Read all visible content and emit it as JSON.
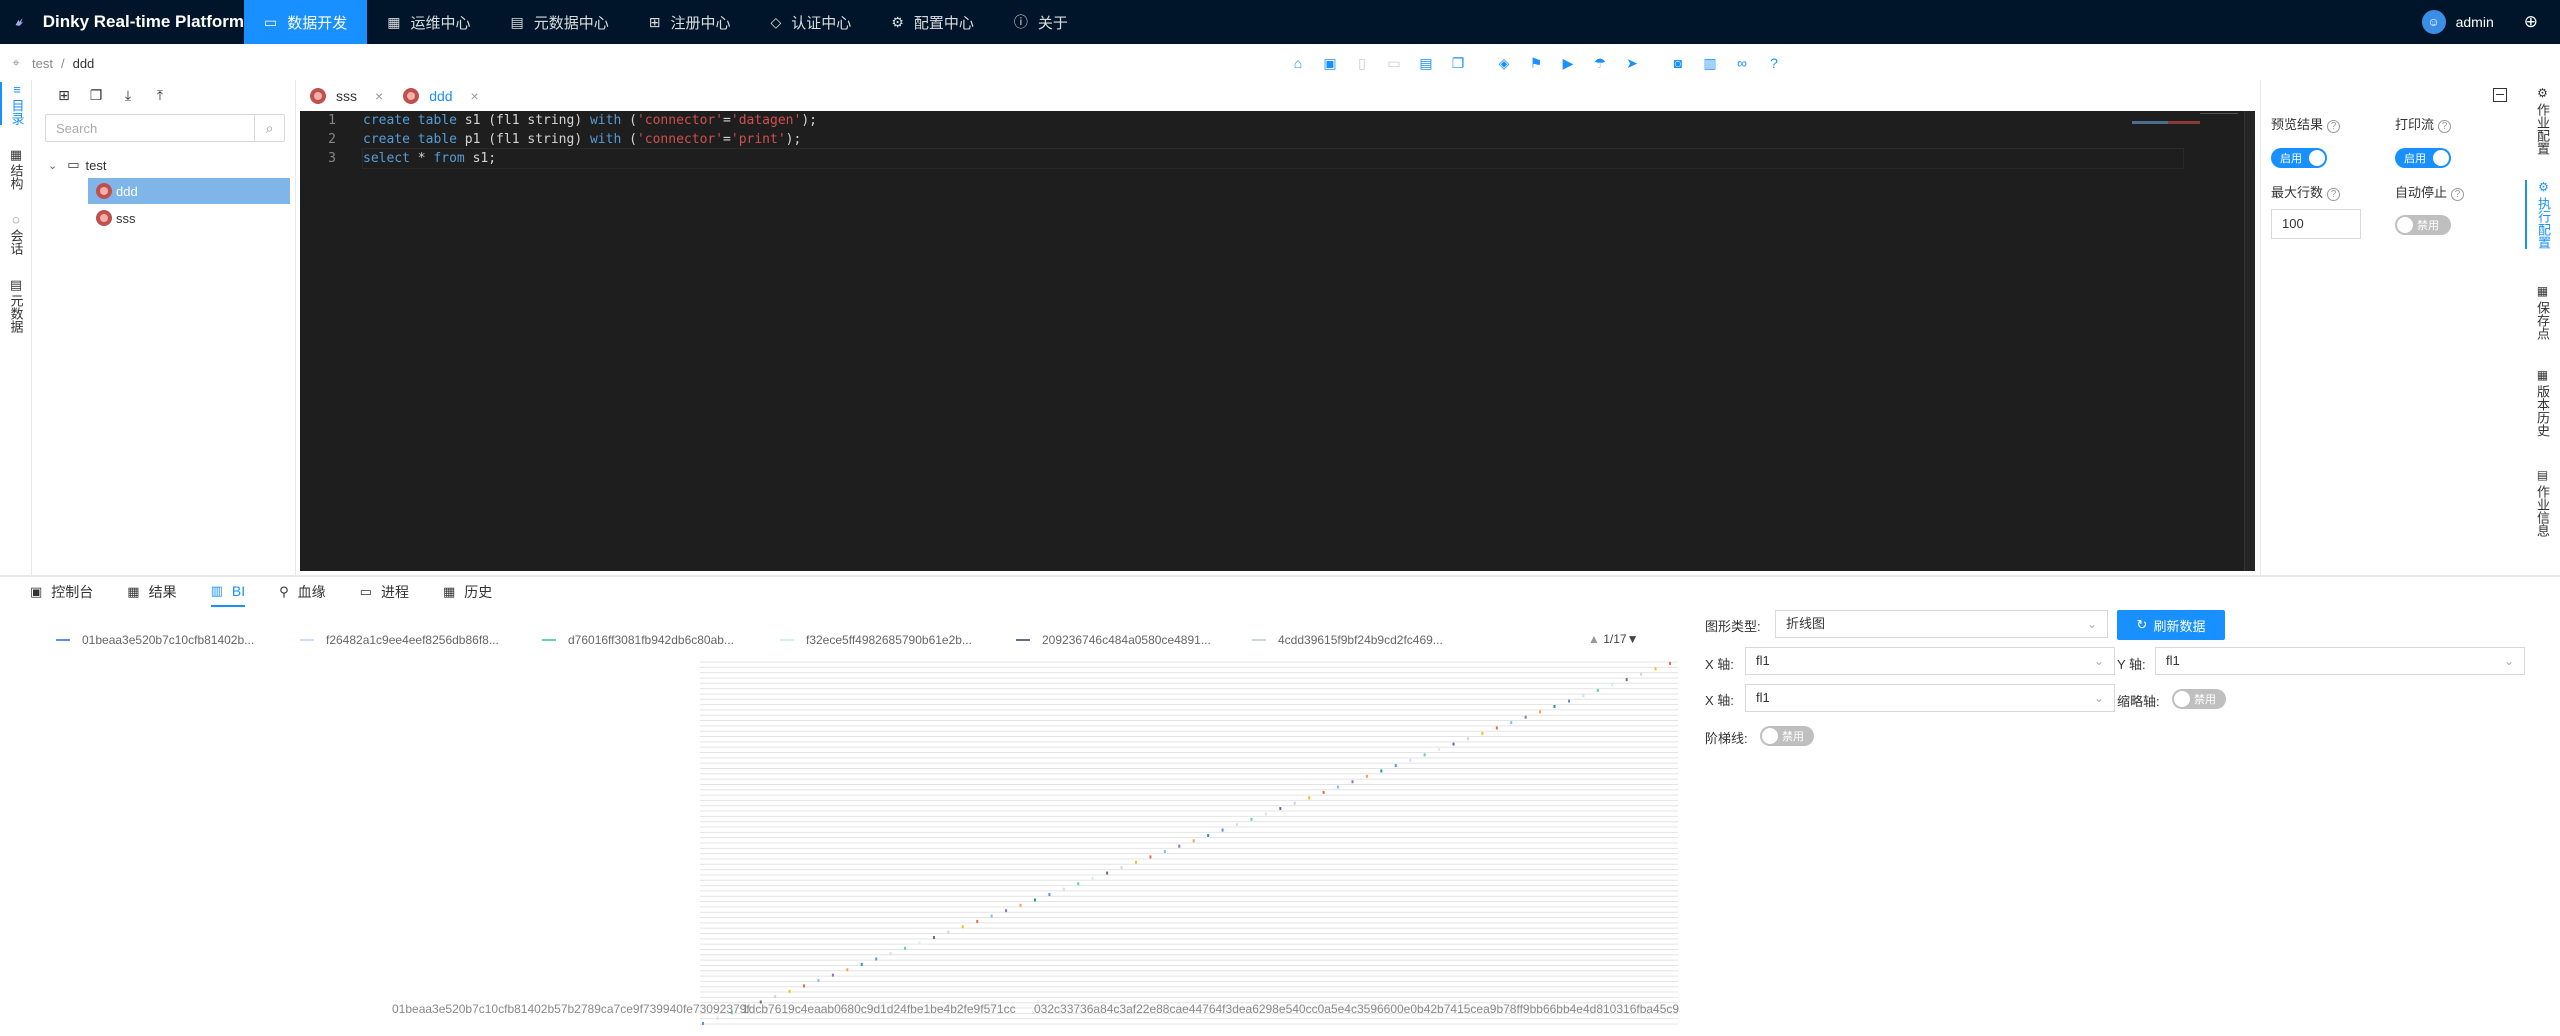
{
  "app": {
    "title": "Dinky Real-time Platform"
  },
  "nav": {
    "items": [
      {
        "label": "数据开发",
        "icon": "dev-icon",
        "active": true
      },
      {
        "label": "运维中心",
        "icon": "ops-icon"
      },
      {
        "label": "元数据中心",
        "icon": "metadata-icon"
      },
      {
        "label": "注册中心",
        "icon": "registry-icon"
      },
      {
        "label": "认证中心",
        "icon": "auth-icon"
      },
      {
        "label": "配置中心",
        "icon": "settings-icon"
      },
      {
        "label": "关于",
        "icon": "info-icon"
      }
    ],
    "user": "admin"
  },
  "breadcrumb": {
    "root": "test",
    "sep": "/",
    "current": "ddd"
  },
  "left_strip": {
    "items": [
      "目录",
      "结构",
      "会话",
      "元数据"
    ]
  },
  "tree": {
    "search_placeholder": "Search",
    "folder": "test",
    "files": [
      "ddd",
      "sss"
    ]
  },
  "tabs": [
    {
      "label": "sss",
      "active": false
    },
    {
      "label": "ddd",
      "active": true
    }
  ],
  "editor": {
    "line_numbers": [
      "1",
      "2",
      "3"
    ]
  },
  "right_panel": {
    "preview_result": {
      "label": "预览结果",
      "value": "启用"
    },
    "print_stream": {
      "label": "打印流",
      "value": "启用"
    },
    "max_rows": {
      "label": "最大行数",
      "value": "100"
    },
    "auto_stop": {
      "label": "自动停止",
      "value": "禁用"
    }
  },
  "right_strip": {
    "items": [
      "作业配置",
      "执行配置",
      "保存点",
      "版本历史",
      "作业信息"
    ]
  },
  "bottom_tabs": [
    "控制台",
    "结果",
    "BI",
    "血缘",
    "进程",
    "历史"
  ],
  "chart_config": {
    "chart_type_label": "图形类型:",
    "chart_type_value": "折线图",
    "refresh_label": "刷新数据",
    "x_axis_label": "X 轴:",
    "x_axis_value": "fl1",
    "y_axis_label": "Y 轴:",
    "y_axis_value": "fl1",
    "x_axis2_label": "X 轴:",
    "x_axis2_value": "fl1",
    "thumb_axis_label": "缩略轴:",
    "thumb_axis_value": "禁用",
    "step_line_label": "阶梯线:",
    "step_line_value": "禁用"
  },
  "chart_data": {
    "type": "line",
    "legend": [
      {
        "name": "01beaa3e520b7c10cfb81402b...",
        "color": "#5b8ff9"
      },
      {
        "name": "f26482a1c9ee4eef8256db86f8...",
        "color": "#cdddfd"
      },
      {
        "name": "d76016ff3081fb942db6c80ab...",
        "color": "#5ad8a6"
      },
      {
        "name": "f32ece5ff4982685790b61e2b...",
        "color": "#cdf3e4"
      },
      {
        "name": "209236746c484a0580ce4891...",
        "color": "#5d7092"
      },
      {
        "name": "4cdd39615f9bf24b9cd2fc469...",
        "color": "#ced4de"
      }
    ],
    "page_indicator": "1/17",
    "x_tick_labels": [
      "01beaa3e520b7c10cfb81402b57b2789ca7ce9f739940fe73092379f",
      "1dcb7619c4eaab0680c9d1d24fbe1be4b2fe9f571cc",
      "032c33736a84c3af22e88cae44764f3dea6298e540cc0a5e4c3596600e0b42b7415cea9b78ff9bb66bb4e4d810316fba45c9"
    ],
    "points_count": 68
  }
}
